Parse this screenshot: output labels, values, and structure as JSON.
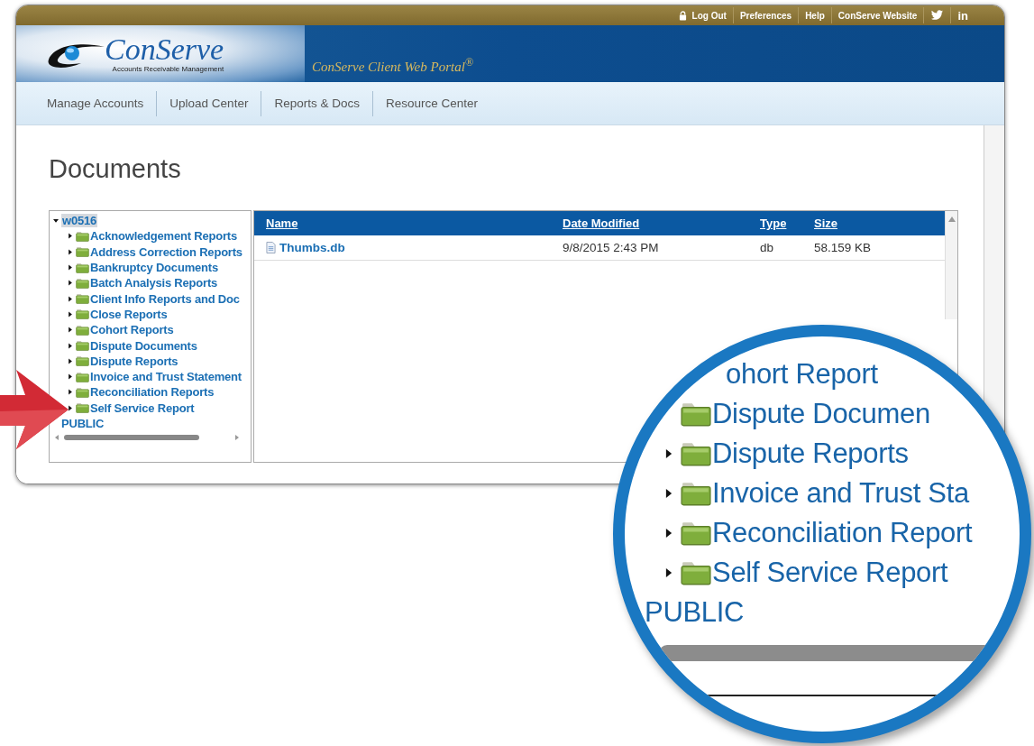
{
  "top_links": [
    {
      "label": "Log Out",
      "kind": "lock"
    },
    {
      "label": "Preferences",
      "kind": "plain"
    },
    {
      "label": "Help",
      "kind": "plain"
    },
    {
      "label": "ConServe Website",
      "kind": "plain"
    },
    {
      "kind": "twitter"
    },
    {
      "label": "in",
      "kind": "plain"
    }
  ],
  "logo": {
    "name": "ConServe",
    "tagline": "Accounts Receivable Management"
  },
  "portal_title": "ConServe Client Web Portal$^{®}$",
  "nav": [
    "Manage Accounts",
    "Upload Center",
    "Reports & Docs",
    "Resource Center"
  ],
  "page_title": "Documents",
  "tree": {
    "root": {
      "label": "w0516",
      "expanded": true,
      "selected": true,
      "children": [
        {
          "label": "Acknowledgement Reports",
          "expanded": false
        },
        {
          "label": "Address Correction Reports",
          "expanded": false
        },
        {
          "label": "Bankruptcy Documents",
          "expanded": false
        },
        {
          "label": "Batch Analysis Reports",
          "expanded": false
        },
        {
          "label": "Client Info Reports and Doc",
          "expanded": false
        },
        {
          "label": "Close Reports",
          "expanded": false
        },
        {
          "label": "Cohort Reports",
          "expanded": false
        },
        {
          "label": "Dispute Documents",
          "expanded": false
        },
        {
          "label": "Dispute Reports",
          "expanded": false
        },
        {
          "label": "Invoice and Trust Statement",
          "expanded": false
        },
        {
          "label": "Reconciliation Reports",
          "expanded": false
        },
        {
          "label": "Self Service Report",
          "expanded": false
        }
      ]
    },
    "others": [
      "PUBLIC"
    ]
  },
  "table": {
    "columns": [
      "Name",
      "Date Modified",
      "Type",
      "Size"
    ],
    "rows": [
      {
        "name": "Thumbs.db",
        "date_modified": "9/8/2015 2:43 PM",
        "type": "db",
        "size": "58.159 KB"
      }
    ]
  },
  "magnifier": {
    "items": [
      {
        "label": "ohort Report",
        "kind": "partial"
      },
      {
        "label": "Dispute Documen",
        "kind": "folder-only"
      },
      {
        "label": "Dispute Reports",
        "kind": "folder"
      },
      {
        "label": "Invoice and Trust Sta",
        "kind": "folder"
      },
      {
        "label": "Reconciliation Report",
        "kind": "folder"
      },
      {
        "label": "Self Service Report",
        "kind": "folder"
      },
      {
        "label": "PUBLIC",
        "kind": "plain"
      }
    ]
  }
}
